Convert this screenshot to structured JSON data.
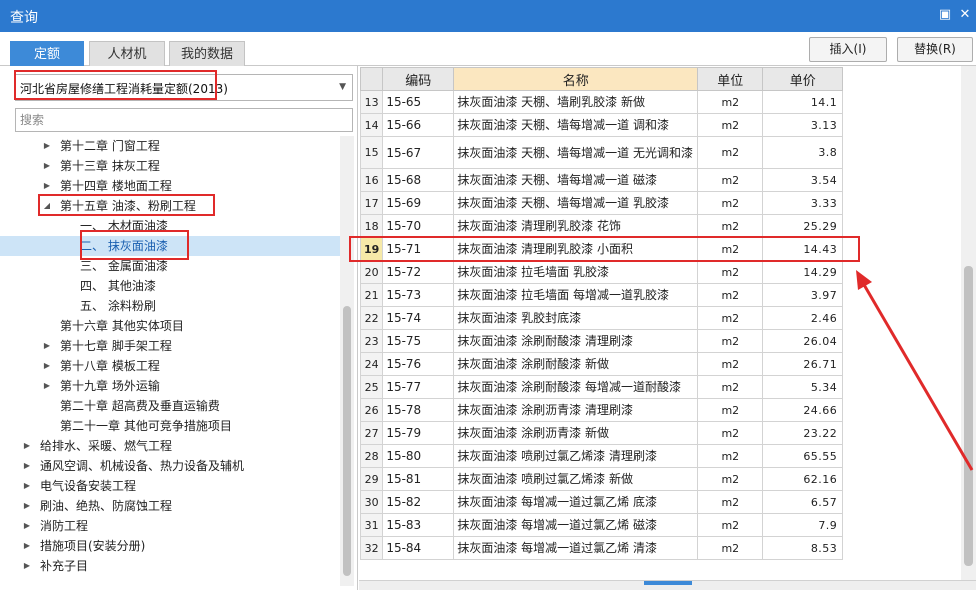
{
  "window": {
    "title": "查询",
    "restore_icon": "restore-icon",
    "close_icon": "close-icon"
  },
  "tabs": [
    {
      "label": "定额",
      "active": true
    },
    {
      "label": "人材机",
      "active": false
    },
    {
      "label": "我的数据",
      "active": false
    }
  ],
  "actions": {
    "insert_label": "插入(I)",
    "replace_label": "替换(R)"
  },
  "left": {
    "library_select": "河北省房屋修缮工程消耗量定额(2013)",
    "search_placeholder": "搜索",
    "tree": [
      {
        "label": "第十二章 门窗工程",
        "expander": "collapsed"
      },
      {
        "label": "第十三章 抹灰工程",
        "expander": "collapsed"
      },
      {
        "label": "第十四章 楼地面工程",
        "expander": "collapsed"
      },
      {
        "label": "第十五章 油漆、粉刷工程",
        "expander": "expanded"
      },
      {
        "label": "一、  木材面油漆",
        "expander": "none"
      },
      {
        "label": "二、  抹灰面油漆",
        "expander": "none",
        "selected": true
      },
      {
        "label": "三、  金属面油漆",
        "expander": "none"
      },
      {
        "label": "四、  其他油漆",
        "expander": "none"
      },
      {
        "label": "五、  涂料粉刷",
        "expander": "none"
      },
      {
        "label": "第十六章 其他实体项目",
        "expander": "none"
      },
      {
        "label": "第十七章 脚手架工程",
        "expander": "collapsed"
      },
      {
        "label": "第十八章 模板工程",
        "expander": "collapsed"
      },
      {
        "label": "第十九章 场外运输",
        "expander": "collapsed"
      },
      {
        "label": "第二十章 超高费及垂直运输费",
        "expander": "none"
      },
      {
        "label": "第二十一章 其他可竞争措施项目",
        "expander": "none"
      },
      {
        "label": "给排水、采暖、燃气工程",
        "expander": "collapsed"
      },
      {
        "label": "通风空调、机械设备、热力设备及辅机",
        "expander": "collapsed"
      },
      {
        "label": "电气设备安装工程",
        "expander": "collapsed"
      },
      {
        "label": "刷油、绝热、防腐蚀工程",
        "expander": "collapsed"
      },
      {
        "label": "消防工程",
        "expander": "collapsed"
      },
      {
        "label": "措施项目(安装分册)",
        "expander": "collapsed"
      },
      {
        "label": "补充子目",
        "expander": "collapsed"
      }
    ]
  },
  "table": {
    "headers": {
      "code": "编码",
      "name": "名称",
      "unit": "单位",
      "price": "单价"
    },
    "rows": [
      {
        "no": "13",
        "code": "15-65",
        "name": "抹灰面油漆 天棚、墙刷乳胶漆 新做",
        "unit": "m2",
        "price": "14.1"
      },
      {
        "no": "14",
        "code": "15-66",
        "name": "抹灰面油漆 天棚、墙每增减一道 调和漆",
        "unit": "m2",
        "price": "3.13"
      },
      {
        "no": "15",
        "code": "15-67",
        "name": "抹灰面油漆 天棚、墙每增减一道 无光调和漆",
        "unit": "m2",
        "price": "3.8"
      },
      {
        "no": "16",
        "code": "15-68",
        "name": "抹灰面油漆 天棚、墙每增减一道 磁漆",
        "unit": "m2",
        "price": "3.54"
      },
      {
        "no": "17",
        "code": "15-69",
        "name": "抹灰面油漆 天棚、墙每增减一道 乳胶漆",
        "unit": "m2",
        "price": "3.33"
      },
      {
        "no": "18",
        "code": "15-70",
        "name": "抹灰面油漆 清理刷乳胶漆 花饰",
        "unit": "m2",
        "price": "25.29"
      },
      {
        "no": "19",
        "code": "15-71",
        "name": "抹灰面油漆 清理刷乳胶漆 小面积",
        "unit": "m2",
        "price": "14.43",
        "highlight": true
      },
      {
        "no": "20",
        "code": "15-72",
        "name": "抹灰面油漆 拉毛墙面 乳胶漆",
        "unit": "m2",
        "price": "14.29"
      },
      {
        "no": "21",
        "code": "15-73",
        "name": "抹灰面油漆 拉毛墙面 每增减一道乳胶漆",
        "unit": "m2",
        "price": "3.97"
      },
      {
        "no": "22",
        "code": "15-74",
        "name": "抹灰面油漆 乳胶封底漆",
        "unit": "m2",
        "price": "2.46"
      },
      {
        "no": "23",
        "code": "15-75",
        "name": "抹灰面油漆 涂刷耐酸漆 清理刷漆",
        "unit": "m2",
        "price": "26.04"
      },
      {
        "no": "24",
        "code": "15-76",
        "name": "抹灰面油漆 涂刷耐酸漆 新做",
        "unit": "m2",
        "price": "26.71"
      },
      {
        "no": "25",
        "code": "15-77",
        "name": "抹灰面油漆 涂刷耐酸漆 每增减一道耐酸漆",
        "unit": "m2",
        "price": "5.34"
      },
      {
        "no": "26",
        "code": "15-78",
        "name": "抹灰面油漆 涂刷沥青漆 清理刷漆",
        "unit": "m2",
        "price": "24.66"
      },
      {
        "no": "27",
        "code": "15-79",
        "name": "抹灰面油漆 涂刷沥青漆 新做",
        "unit": "m2",
        "price": "23.22"
      },
      {
        "no": "28",
        "code": "15-80",
        "name": "抹灰面油漆 喷刷过氯乙烯漆 清理刷漆",
        "unit": "m2",
        "price": "65.55"
      },
      {
        "no": "29",
        "code": "15-81",
        "name": "抹灰面油漆 喷刷过氯乙烯漆 新做",
        "unit": "m2",
        "price": "62.16"
      },
      {
        "no": "30",
        "code": "15-82",
        "name": "抹灰面油漆 每增减一道过氯乙烯 底漆",
        "unit": "m2",
        "price": "6.57"
      },
      {
        "no": "31",
        "code": "15-83",
        "name": "抹灰面油漆 每增减一道过氯乙烯 磁漆",
        "unit": "m2",
        "price": "7.9"
      },
      {
        "no": "32",
        "code": "15-84",
        "name": "抹灰面油漆 每增减一道过氯乙烯 清漆",
        "unit": "m2",
        "price": "8.53"
      }
    ]
  },
  "colors": {
    "titlebar": "#2c79cf",
    "tab_active": "#3d8ad8",
    "annotation_red": "#e02a2a",
    "row_highlight_number": "#f6e9a8"
  }
}
